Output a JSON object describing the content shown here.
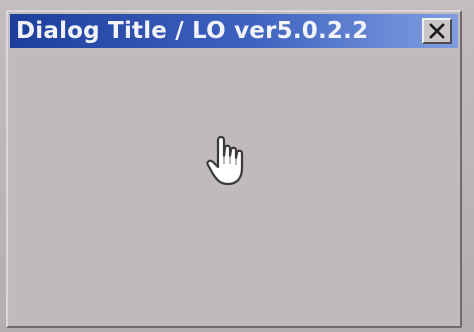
{
  "window": {
    "title": "Dialog Title / LO ver5.0.2.2"
  },
  "titlebar": {
    "close_icon": "close-icon",
    "close_label": "Close"
  },
  "cursor": {
    "icon": "hand-pointer-cursor-icon"
  },
  "colors": {
    "titlebar_start": "#1d3f9c",
    "titlebar_end": "#7f9ee0",
    "title_text": "#f3f3fb",
    "window_bg": "#c2bcbe"
  }
}
